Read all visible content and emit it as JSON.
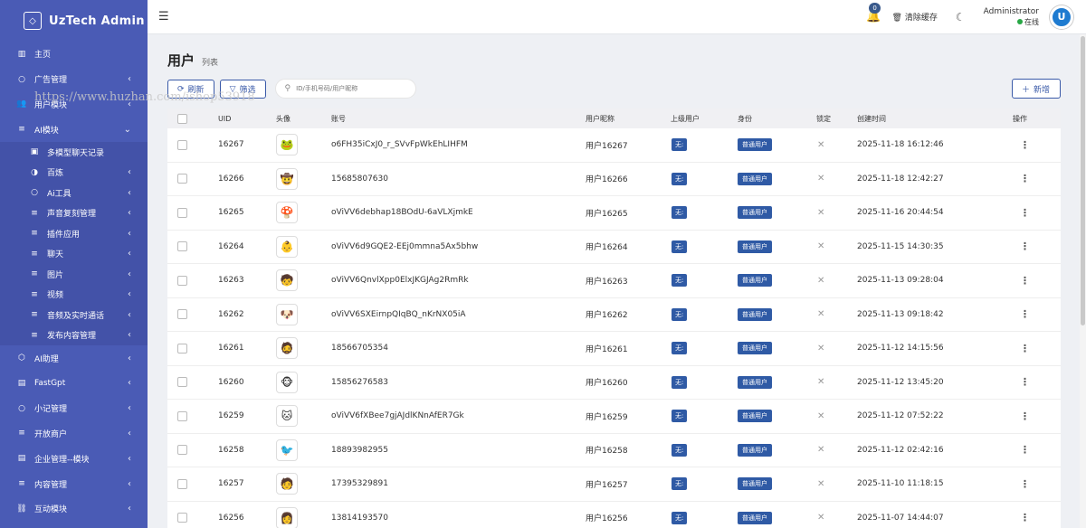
{
  "brand": {
    "title": "UzTech Admin"
  },
  "sidebar": {
    "items": [
      {
        "label": "主页",
        "icon": "bar-chart-icon",
        "arrow": ""
      },
      {
        "label": "广告管理",
        "icon": "circle-icon",
        "arrow": "‹"
      },
      {
        "label": "用户模块",
        "icon": "users-icon",
        "arrow": "‹"
      },
      {
        "label": "AI模块",
        "icon": "list-icon",
        "arrow": "⌄"
      }
    ],
    "sub": [
      {
        "label": "多模型聊天记录",
        "icon": "user-square-icon",
        "arrow": ""
      },
      {
        "label": "百炼",
        "icon": "half-circle-icon",
        "arrow": "‹"
      },
      {
        "label": "Ai工具",
        "icon": "circle-icon",
        "arrow": "‹"
      },
      {
        "label": "声音复刻管理",
        "icon": "list-icon",
        "arrow": "‹"
      },
      {
        "label": "插件应用",
        "icon": "list-icon",
        "arrow": "‹"
      },
      {
        "label": "聊天",
        "icon": "list-icon",
        "arrow": "‹"
      },
      {
        "label": "图片",
        "icon": "list-icon",
        "arrow": "‹"
      },
      {
        "label": "视频",
        "icon": "list-icon",
        "arrow": "‹"
      },
      {
        "label": "音频及实时通话",
        "icon": "list-icon",
        "arrow": "‹"
      },
      {
        "label": "发布内容管理",
        "icon": "list-icon",
        "arrow": "‹"
      }
    ],
    "items2": [
      {
        "label": "AI助理",
        "icon": "cube-icon",
        "arrow": "‹"
      },
      {
        "label": "FastGpt",
        "icon": "ticket-icon",
        "arrow": "‹"
      },
      {
        "label": "小记管理",
        "icon": "circle-icon",
        "arrow": "‹"
      },
      {
        "label": "开放商户",
        "icon": "list-icon",
        "arrow": "‹"
      },
      {
        "label": "企业管理--模块",
        "icon": "ticket-icon",
        "arrow": "‹"
      },
      {
        "label": "内容管理",
        "icon": "list-icon",
        "arrow": "‹"
      },
      {
        "label": "互动模块",
        "icon": "link-icon",
        "arrow": "‹"
      }
    ]
  },
  "topbar": {
    "badge": "0",
    "clear_cache": "清除缓存",
    "username": "Administrator",
    "status": "在线",
    "avatar_letter": "U"
  },
  "page": {
    "title": "用户",
    "subtitle": "列表"
  },
  "toolbar": {
    "refresh": "刷新",
    "filter": "筛选",
    "search_placeholder": "ID/手机号码/用户昵称",
    "add": "新增"
  },
  "watermark": "https://www.huzhan.com/ishop53918",
  "table": {
    "headers": {
      "uid": "UID",
      "avatar": "头像",
      "account": "账号",
      "nickname": "用户昵称",
      "parent": "上级用户",
      "role": "身份",
      "lock": "锁定",
      "created": "创建时间",
      "ops": "操作"
    },
    "rows": [
      {
        "uid": "16267",
        "emoji": "🐸",
        "account": "o6FH35iCxJ0_r_SVvFpWkEhLIHFM",
        "nickname": "用户16267",
        "parent": "无",
        "role": "普通用户",
        "created": "2025-11-18 16:12:46"
      },
      {
        "uid": "16266",
        "emoji": "🤠",
        "account": "15685807630",
        "nickname": "用户16266",
        "parent": "无",
        "role": "普通用户",
        "created": "2025-11-18 12:42:27"
      },
      {
        "uid": "16265",
        "emoji": "🍄",
        "account": "oViVV6debhap18BOdU-6aVLXjmkE",
        "nickname": "用户16265",
        "parent": "无",
        "role": "普通用户",
        "created": "2025-11-16 20:44:54"
      },
      {
        "uid": "16264",
        "emoji": "👶",
        "account": "oViVV6d9GQE2-EEj0mmna5Ax5bhw",
        "nickname": "用户16264",
        "parent": "无",
        "role": "普通用户",
        "created": "2025-11-15 14:30:35"
      },
      {
        "uid": "16263",
        "emoji": "🧒",
        "account": "oViVV6QnvlXpp0ElxJKGJAg2RmRk",
        "nickname": "用户16263",
        "parent": "无",
        "role": "普通用户",
        "created": "2025-11-13 09:28:04"
      },
      {
        "uid": "16262",
        "emoji": "🐶",
        "account": "oViVV6SXEirnpQIqBQ_nKrNX05iA",
        "nickname": "用户16262",
        "parent": "无",
        "role": "普通用户",
        "created": "2025-11-13 09:18:42"
      },
      {
        "uid": "16261",
        "emoji": "🧔",
        "account": "18566705354",
        "nickname": "用户16261",
        "parent": "无",
        "role": "普通用户",
        "created": "2025-11-12 14:15:56"
      },
      {
        "uid": "16260",
        "emoji": "🐵",
        "account": "15856276583",
        "nickname": "用户16260",
        "parent": "无",
        "role": "普通用户",
        "created": "2025-11-12 13:45:20"
      },
      {
        "uid": "16259",
        "emoji": "🐱",
        "account": "oViVV6fXBee7gjAJdlKNnAfER7Gk",
        "nickname": "用户16259",
        "parent": "无",
        "role": "普通用户",
        "created": "2025-11-12 07:52:22"
      },
      {
        "uid": "16258",
        "emoji": "🐦",
        "account": "18893982955",
        "nickname": "用户16258",
        "parent": "无",
        "role": "普通用户",
        "created": "2025-11-12 02:42:16"
      },
      {
        "uid": "16257",
        "emoji": "🧑",
        "account": "17395329891",
        "nickname": "用户16257",
        "parent": "无",
        "role": "普通用户",
        "created": "2025-11-10 11:18:15"
      },
      {
        "uid": "16256",
        "emoji": "👩",
        "account": "13814193570",
        "nickname": "用户16256",
        "parent": "无",
        "role": "普通用户",
        "created": "2025-11-07 14:44:07"
      }
    ]
  }
}
